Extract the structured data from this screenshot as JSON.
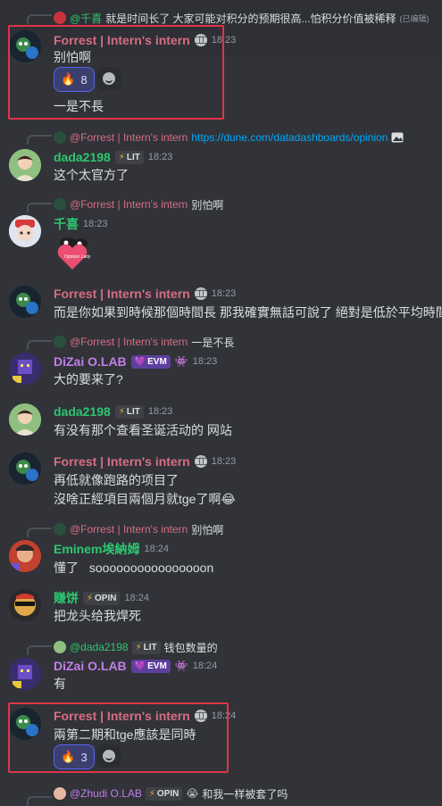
{
  "colors": {
    "highlight": "#e0344a",
    "forrest": "#d76d85",
    "green": "#2dc770",
    "purple": "#c17fe8"
  },
  "messages": [
    {
      "reply_user": "@千喜",
      "reply_text": "就是时间长了 大家可能对积分的预期很高...怕积分价值被稀释",
      "reply_edited": "(已编辑)",
      "user": "Forrest | Intern's intern",
      "time": "18:23",
      "lines": [
        "别怕啊"
      ],
      "reaction": "8",
      "extra_line": "一是不長"
    },
    {
      "reply_user": "@Forrest | Intern's intern",
      "reply_link": "https://dune.com/datadashboards/opinion",
      "user": "dada2198",
      "tag": "LIT",
      "time": "18:23",
      "lines": [
        "这个太官方了"
      ]
    },
    {
      "reply_user": "@Forrest | Intern's intern",
      "reply_text": "别怕啊",
      "user": "千喜",
      "time": "18:23"
    },
    {
      "user": "Forrest | Intern's intern",
      "time": "18:23",
      "lines": [
        "而是你如果到時候那個時間長 那我確實無話可說了 絕對是低於平均時間的"
      ]
    },
    {
      "reply_user": "@Forrest | Intern's intern",
      "reply_text": "一是不長",
      "user": "DiZai O.LAB",
      "tag": "EVM",
      "time": "18:23",
      "lines": [
        "大的要来了?"
      ]
    },
    {
      "user": "dada2198",
      "tag": "LIT",
      "time": "18:23",
      "lines": [
        "有没有那个查看圣诞活动的 网站"
      ]
    },
    {
      "user": "Forrest | Intern's intern",
      "time": "18:23",
      "lines": [
        "再低就像跑路的项目了",
        "沒啥正經項目兩個月就tge了啊😂"
      ]
    },
    {
      "reply_user": "@Forrest | Intern's intern",
      "reply_text": "别怕啊",
      "user": "Eminem埃納姆",
      "time": "18:24",
      "lines": [
        "懂了",
        "soooooooooooooooon"
      ]
    },
    {
      "user": "赚饼",
      "tag": "OPIN",
      "time": "18:24",
      "lines": [
        "把龙头给我焊死"
      ]
    },
    {
      "reply_user": "@dada2198",
      "reply_tag": "LIT",
      "reply_text": "钱包数量的",
      "user": "DiZai O.LAB",
      "tag": "EVM",
      "time": "18:24",
      "lines": [
        "有"
      ]
    },
    {
      "user": "Forrest | Intern's intern",
      "time": "18:24",
      "lines": [
        "兩第二期和tge應該是同時"
      ],
      "reaction": "3"
    },
    {
      "reply_user": "@Zhudi O.LAB",
      "reply_tag": "OPIN",
      "reply_text": "和我一样被套了吗"
    }
  ],
  "sticker_text": "Opinion Lady"
}
